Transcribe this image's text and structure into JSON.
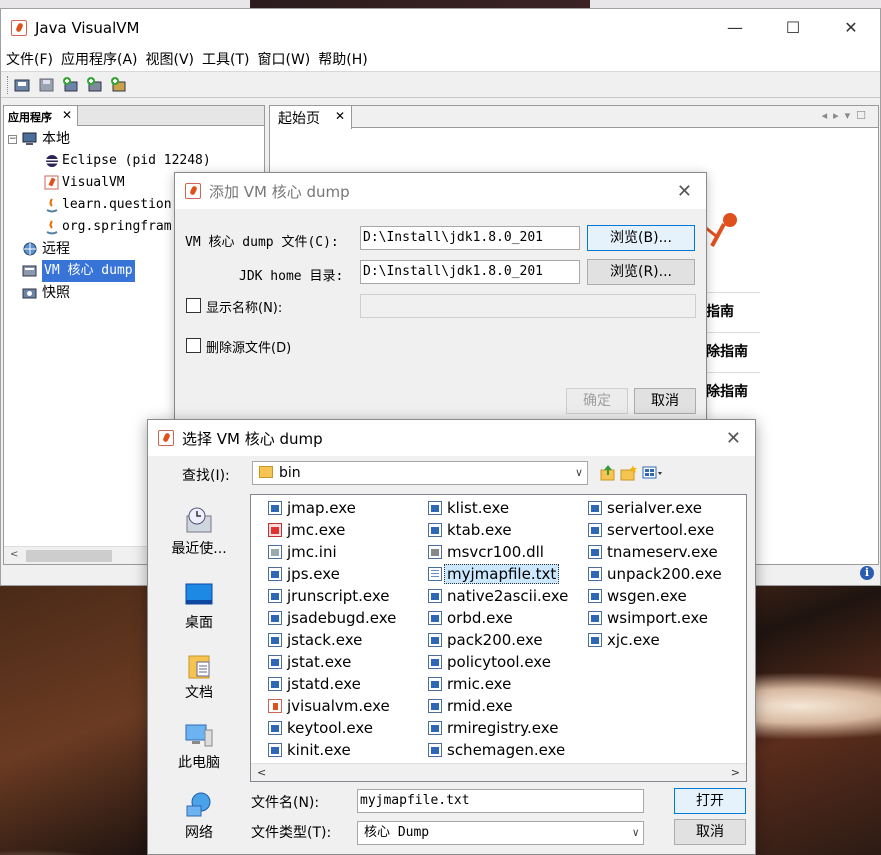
{
  "main_window": {
    "title": "Java VisualVM",
    "controls": {
      "minimize": "—",
      "maximize": "☐",
      "close": "✕"
    },
    "menu": [
      "文件(F)",
      "应用程序(A)",
      "视图(V)",
      "工具(T)",
      "窗口(W)",
      "帮助(H)"
    ]
  },
  "left_panel": {
    "tab_label": "应用程序",
    "tab_close": "✕",
    "tree": {
      "local": "本地",
      "local_children": [
        "Eclipse (pid 12248)",
        "VisualVM",
        "learn.question",
        "org.springfram"
      ],
      "remote": "远程",
      "core_dump": "VM 核心 dump",
      "snapshots": "快照"
    }
  },
  "right_panel": {
    "tab_label": "起始页",
    "tab_close": "✕",
    "guides": [
      "指南",
      "除指南",
      "除指南"
    ]
  },
  "add_dump_dialog": {
    "title": "添加 VM 核心 dump",
    "close": "✕",
    "dump_file_label": "VM 核心 dump 文件(C):",
    "dump_file_value": "D:\\Install\\jdk1.8.0_201",
    "browse_b": "浏览(B)...",
    "jdk_home_label": "JDK home 目录:",
    "jdk_home_value": "D:\\Install\\jdk1.8.0_201",
    "browse_r": "浏览(R)...",
    "display_name_label": "显示名称(N):",
    "delete_source_label": "删除源文件(D)",
    "ok": "确定",
    "cancel": "取消"
  },
  "file_chooser": {
    "title": "选择 VM 核心 dump",
    "close": "✕",
    "lookin_label": "查找(I):",
    "lookin_value": "bin",
    "places": [
      "最近使...",
      "桌面",
      "文档",
      "此电脑",
      "网络"
    ],
    "files_col1": [
      "jmap.exe",
      "jmc.exe",
      "jmc.ini",
      "jps.exe",
      "jrunscript.exe",
      "jsadebugd.exe",
      "jstack.exe",
      "jstat.exe",
      "jstatd.exe",
      "jvisualvm.exe",
      "keytool.exe",
      "kinit.exe"
    ],
    "files_col2": [
      "klist.exe",
      "ktab.exe",
      "msvcr100.dll",
      "myjmapfile.txt",
      "native2ascii.exe",
      "orbd.exe",
      "pack200.exe",
      "policytool.exe",
      "rmic.exe",
      "rmid.exe",
      "rmiregistry.exe",
      "schemagen.exe"
    ],
    "files_col3": [
      "serialver.exe",
      "servertool.exe",
      "tnameserv.exe",
      "unpack200.exe",
      "wsgen.exe",
      "wsimport.exe",
      "xjc.exe"
    ],
    "selected_file": "myjmapfile.txt",
    "filename_label": "文件名(N):",
    "filename_value": "myjmapfile.txt",
    "filetype_label": "文件类型(T):",
    "filetype_value": "核心 Dump",
    "open": "打开",
    "cancel": "取消"
  },
  "colors": {
    "selection": "#3874d8",
    "file_selection": "#cce8ff",
    "focus_border": "#0078d7"
  }
}
